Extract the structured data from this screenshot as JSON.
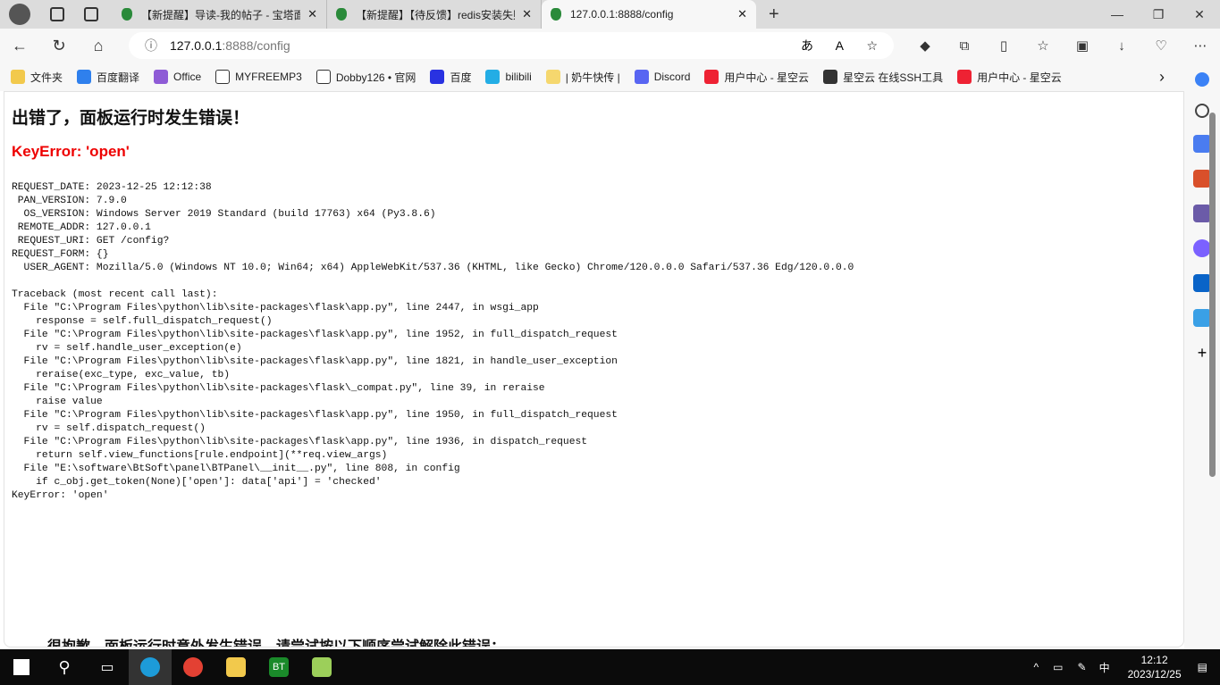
{
  "tabs": [
    {
      "title": "【新提醒】导读-我的帖子 - 宝塔面板",
      "active": false
    },
    {
      "title": "【新提醒】【待反馈】redis安装失败",
      "active": false
    },
    {
      "title": "127.0.0.1:8888/config",
      "active": true
    }
  ],
  "address": {
    "host": "127.0.0.1",
    "path": ":8888/config"
  },
  "bookmarks": [
    {
      "label": "文件夹",
      "color": "#f2c94c"
    },
    {
      "label": "百度翻译",
      "color": "#2f80ed"
    },
    {
      "label": "Office",
      "color": "#8e5bd6"
    },
    {
      "label": "MYFREEMP3",
      "color": "#ffffff"
    },
    {
      "label": "Dobby126 • 官网",
      "color": "#ffffff"
    },
    {
      "label": "百度",
      "color": "#2932e1"
    },
    {
      "label": "bilibili",
      "color": "#23ade5"
    },
    {
      "label": "| 奶牛快传 |",
      "color": "#f5d76e"
    },
    {
      "label": "Discord",
      "color": "#5865f2"
    },
    {
      "label": "用户中心 - 星空云",
      "color": "#e23"
    },
    {
      "label": "星空云 在线SSH工具",
      "color": "#333"
    },
    {
      "label": "用户中心 - 星空云",
      "color": "#e23"
    }
  ],
  "page": {
    "title": "出错了，面板运行时发生错误！",
    "error": "KeyError: 'open'",
    "details": "REQUEST_DATE: 2023-12-25 12:12:38\n PAN_VERSION: 7.9.0\n  OS_VERSION: Windows Server 2019 Standard (build 17763) x64 (Py3.8.6)\n REMOTE_ADDR: 127.0.0.1\n REQUEST_URI: GET /config?\nREQUEST_FORM: {}\n  USER_AGENT: Mozilla/5.0 (Windows NT 10.0; Win64; x64) AppleWebKit/537.36 (KHTML, like Gecko) Chrome/120.0.0.0 Safari/537.36 Edg/120.0.0.0\n\nTraceback (most recent call last):\n  File \"C:\\Program Files\\python\\lib\\site-packages\\flask\\app.py\", line 2447, in wsgi_app\n    response = self.full_dispatch_request()\n  File \"C:\\Program Files\\python\\lib\\site-packages\\flask\\app.py\", line 1952, in full_dispatch_request\n    rv = self.handle_user_exception(e)\n  File \"C:\\Program Files\\python\\lib\\site-packages\\flask\\app.py\", line 1821, in handle_user_exception\n    reraise(exc_type, exc_value, tb)\n  File \"C:\\Program Files\\python\\lib\\site-packages\\flask\\_compat.py\", line 39, in reraise\n    raise value\n  File \"C:\\Program Files\\python\\lib\\site-packages\\flask\\app.py\", line 1950, in full_dispatch_request\n    rv = self.dispatch_request()\n  File \"C:\\Program Files\\python\\lib\\site-packages\\flask\\app.py\", line 1936, in dispatch_request\n    return self.view_functions[rule.endpoint](**req.view_args)\n  File \"E:\\software\\BtSoft\\panel\\BTPanel\\__init__.py\", line 808, in config\n    if c_obj.get_token(None)['open']: data['api'] = 'checked'\nKeyError: 'open'",
    "sorry": "很抱歉，面板运行时意外发生错误，请尝试按以下顺序尝试解除此错误："
  },
  "taskbar": {
    "ime": "中",
    "time": "12:12",
    "date": "2023/12/25"
  }
}
